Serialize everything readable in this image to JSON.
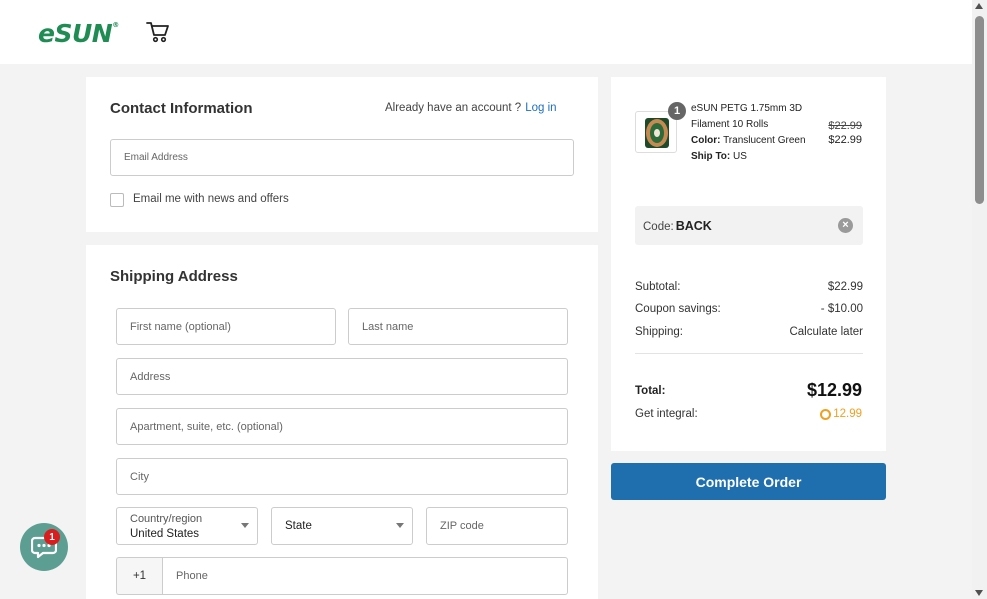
{
  "brand": {
    "logo_text": "eSUN",
    "logo_mark": "®",
    "color": "#1f8c54"
  },
  "header": {
    "cart_icon": "cart-icon"
  },
  "contact": {
    "title": "Contact Information",
    "account_prompt": "Already have an account ?",
    "login_link": "Log in",
    "email_placeholder": "Email Address",
    "newsletter_label": "Email me with news and offers"
  },
  "shipping": {
    "title": "Shipping Address",
    "first_name_placeholder": "First name (optional)",
    "last_name_placeholder": "Last name",
    "address_placeholder": "Address",
    "apartment_placeholder": "Apartment, suite, etc. (optional)",
    "city_placeholder": "City",
    "country_label": "Country/region",
    "country_value": "United States",
    "state_label": "State",
    "zip_placeholder": "ZIP code",
    "phone_prefix": "+1",
    "phone_placeholder": "Phone"
  },
  "order": {
    "item": {
      "quantity": "1",
      "name": "eSUN PETG 1.75mm 3D Filament 10 Rolls",
      "color_label": "Color:",
      "color_value": "Translucent Green",
      "ship_label": "Ship To:",
      "ship_value": "US",
      "original_price": "$22.99",
      "price": "$22.99"
    },
    "coupon": {
      "label": "Code:",
      "code": "BACK"
    },
    "subtotal_label": "Subtotal:",
    "subtotal_value": "$22.99",
    "coupon_savings_label": "Coupon savings:",
    "coupon_savings_value": "- $10.00",
    "shipping_label": "Shipping:",
    "shipping_value": "Calculate later",
    "total_label": "Total:",
    "total_value": "$12.99",
    "integral_label": "Get integral:",
    "integral_value": "12.99",
    "integral_color": "#f0a020"
  },
  "actions": {
    "complete_order": "Complete Order",
    "button_color": "#1f6fae"
  },
  "chat": {
    "badge_count": "1"
  }
}
